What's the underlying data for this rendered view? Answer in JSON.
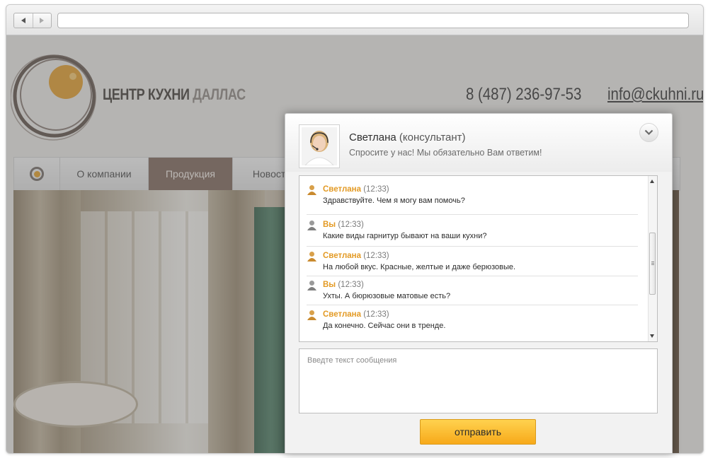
{
  "site": {
    "logo_text_main": "ЦЕНТР КУХНИ",
    "logo_text_accent": "ДАЛЛАС",
    "phone": "8 (487) 236-97-53",
    "email": "info@ckuhni.ru",
    "nav": [
      {
        "label": "О компании",
        "active": false
      },
      {
        "label": "Продукция",
        "active": true
      },
      {
        "label": "Новости",
        "active": false
      }
    ]
  },
  "chat": {
    "agent_name": "Светлана",
    "agent_role": "(консультант)",
    "agent_subtitle": "Спросите у нас! Мы обязательно Вам ответим!",
    "messages": [
      {
        "sender": "Светлана",
        "time": "(12:33)",
        "text": "Здравствуйте. Чем я могу вам помочь?",
        "from": "agent"
      },
      {
        "sender": "Вы",
        "time": "(12:33)",
        "text": "Какие виды гарнитур бывают на ваши кухни?",
        "from": "user"
      },
      {
        "sender": "Светлана",
        "time": "(12:33)",
        "text": "На любой вкус. Красные, желтые и даже берюзовые.",
        "from": "agent"
      },
      {
        "sender": "Вы",
        "time": "(12:33)",
        "text": "Ухты. А бюрюзовые матовые есть?",
        "from": "user"
      },
      {
        "sender": "Светлана",
        "time": "(12:33)",
        "text": "Да конечно. Сейчас они в тренде.",
        "from": "agent"
      }
    ],
    "input_placeholder": "Введте текст сообщения",
    "send_label": "отправить"
  },
  "colors": {
    "accent": "#e39a24",
    "send_button": "#f7a91a",
    "nav_active": "#7a6356"
  }
}
